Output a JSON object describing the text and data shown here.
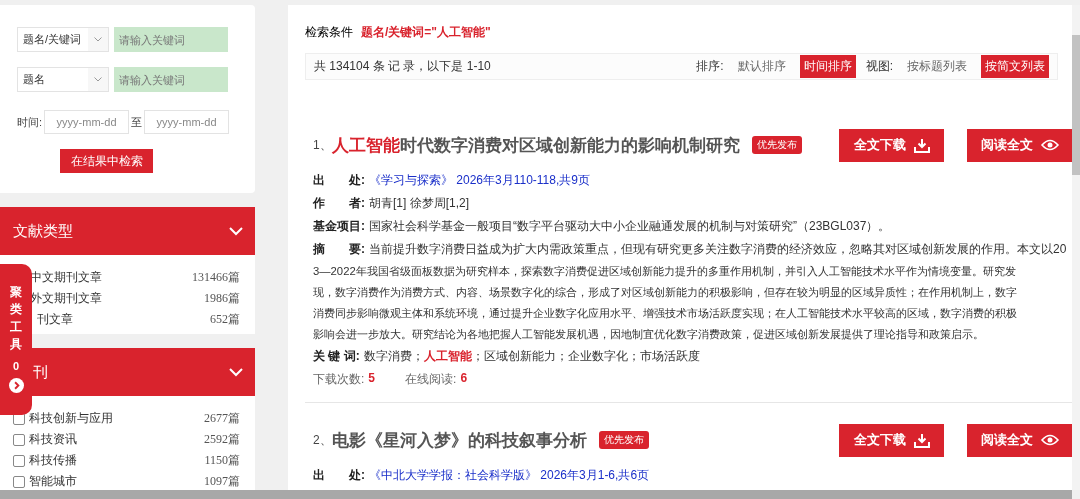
{
  "search_form": {
    "rows": [
      {
        "field": "题名/关键词",
        "placeholder": "请输入关键词"
      },
      {
        "field": "题名",
        "placeholder": "请输入关键词"
      }
    ],
    "time_label": "时间:",
    "date_from": {
      "placeholder": "yyyy-mm-dd"
    },
    "date_sep": "至",
    "date_to": {
      "placeholder": "yyyy-mm-dd"
    },
    "submit": "在结果中检索"
  },
  "facets": [
    {
      "title": "文献类型",
      "expanded": true,
      "items": [
        {
          "label": "中文期刊文章",
          "count": "131466篇"
        },
        {
          "label": "外文期刊文章",
          "count": "1986篇"
        },
        {
          "label": "刊文章",
          "count": "652篇"
        }
      ]
    },
    {
      "title": "刊",
      "expanded": true,
      "items": [
        {
          "label": "科技创新与应用",
          "count": "2677篇",
          "checked": false
        },
        {
          "label": "科技资讯",
          "count": "2592篇",
          "checked": false
        },
        {
          "label": "科技传播",
          "count": "1150篇",
          "checked": false
        },
        {
          "label": "智能城市",
          "count": "1097篇",
          "checked": false
        }
      ]
    }
  ],
  "cluster_tool": {
    "label": "聚类工具",
    "count": "0"
  },
  "condition": {
    "label": "检索条件",
    "value": "题名/关键词=\"人工智能\""
  },
  "result_bar": {
    "summary": "共 134104 条 记 录，以下是 1-10",
    "sort_label": "排序:",
    "sorts": [
      {
        "label": "默认排序",
        "selected": false
      },
      {
        "label": "时间排序",
        "selected": true
      }
    ],
    "view_label": "视图:",
    "views": [
      {
        "label": "按标题列表",
        "selected": false
      },
      {
        "label": "按简文列表",
        "selected": true
      }
    ]
  },
  "results": [
    {
      "index": "1、",
      "title": [
        {
          "text": "人工智能",
          "highlight": true
        },
        {
          "text": "时代数字消费对区域创新能力的影响机制研究",
          "highlight": false
        }
      ],
      "badge": "优先发布",
      "download": "全文下载",
      "read": "阅读全文",
      "fields": [
        {
          "kind": "link",
          "label": "出　　处:",
          "value": "《学习与探索》 2026年3月110-118,共9页"
        },
        {
          "kind": "text",
          "label": "作　　者:",
          "value": "胡青[1]   徐梦周[1,2]"
        },
        {
          "kind": "text",
          "label": "基金项目:",
          "value": "国家社会科学基金一般项目“数字平台驱动大中小企业融通发展的机制与对策研究”（23BGL037）。"
        }
      ],
      "abstract_label": "摘　　要:",
      "abstract_lines": [
        "当前提升数字消费日益成为扩大内需政策重点，但现有研究更多关注数字消费的经济效应，忽略其对区域创新发展的作用。本文以20",
        "3—2022年我国省级面板数据为研究样本，探索数字消费促进区域创新能力提升的多重作用机制，并引入人工智能技术水平作为情境变量。研究发",
        "现，数字消费作为消费方式、内容、场景数字化的综合，形成了对区域创新能力的积极影响，但存在较为明显的区域异质性；在作用机制上，数字",
        "消费同步影响微观主体和系统环境，通过提升企业数字化应用水平、增强技术市场活跃度实现；在人工智能技术水平较高的区域，数字消费的积极",
        "影响会进一步放大。研究结论为各地把握人工智能发展机遇，因地制宜优化数字消费政策，促进区域创新发展提供了理论指导和政策启示。"
      ],
      "keywords_label": "关 键 词:",
      "keyword_separator": "；",
      "keywords": [
        {
          "text": "数字消费",
          "highlight": false
        },
        {
          "text": "人工智能",
          "highlight": true
        },
        {
          "text": "区域创新能力",
          "highlight": false
        },
        {
          "text": "企业数字化",
          "highlight": false
        },
        {
          "text": "市场活跃度",
          "highlight": false
        }
      ],
      "stats": [
        {
          "label": "下载次数:",
          "value": "5"
        },
        {
          "label": "在线阅读:",
          "value": "6"
        }
      ]
    },
    {
      "index": "2、",
      "title": [
        {
          "text": "电影《星河入梦》的科技叙事分析",
          "highlight": false
        }
      ],
      "badge": "优先发布",
      "download": "全文下载",
      "read": "阅读全文",
      "fields": [
        {
          "kind": "link",
          "label": "出　　处:",
          "value": "《中北大学学报：社会科学版》 2026年3月1-6,共6页"
        }
      ]
    }
  ]
}
